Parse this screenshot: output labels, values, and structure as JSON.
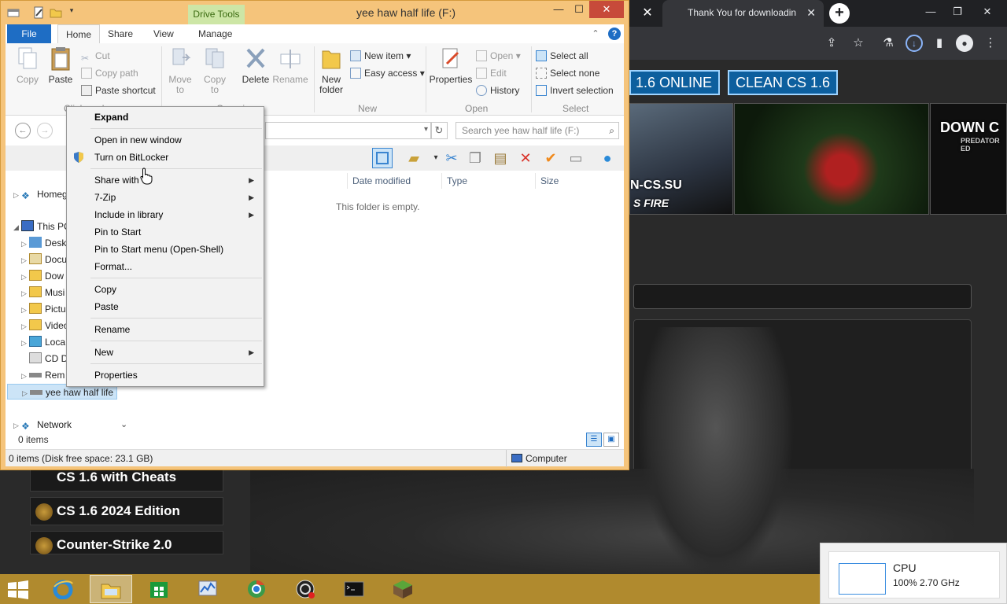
{
  "browser": {
    "tab_title": "Thank You for downloadin",
    "site": {
      "buttons": [
        "1.6 ONLINE",
        "CLEAN CS 1.6"
      ],
      "thumb_texts": [
        "N-CS.SU",
        "S FIRE",
        "DOWN C",
        "PREDATOR ED"
      ],
      "side_items": [
        "CS 1.6 with Cheats",
        "CS 1.6 2024 Edition",
        "Counter-Strike 2.0"
      ]
    }
  },
  "explorer": {
    "contextual_tab": "Drive Tools",
    "title": "yee haw half life (F:)",
    "tabs": {
      "file": "File",
      "home": "Home",
      "share": "Share",
      "view": "View",
      "manage": "Manage"
    },
    "ribbon": {
      "copy": "Copy",
      "paste": "Paste",
      "cut": "Cut",
      "copy_path": "Copy path",
      "paste_shortcut": "Paste shortcut",
      "clipboard_label": "Clipboard",
      "move_to": "Move\nto",
      "copy_to": "Copy\nto",
      "delete": "Delete",
      "rename": "Rename",
      "organize_label": "Organize",
      "new_folder": "New\nfolder",
      "new_item": "New item",
      "easy_access": "Easy access",
      "new_label": "New",
      "properties": "Properties",
      "open": "Open",
      "edit": "Edit",
      "history": "History",
      "open_label": "Open",
      "select_all": "Select all",
      "select_none": "Select none",
      "invert_selection": "Invert selection",
      "select_label": "Select"
    },
    "search_placeholder": "Search yee haw half life (F:)",
    "nav": {
      "homegroup": "Homeg",
      "this_pc": "This PC",
      "desktop": "Desk",
      "documents": "Docu",
      "downloads": "Dow",
      "music": "Musi",
      "pictures": "Pictu",
      "videos": "Video",
      "local_disk": "Loca",
      "cd_drive": "CD D",
      "removable": "Rem",
      "drive": "yee haw half life",
      "network": "Network"
    },
    "columns": {
      "date_modified": "Date modified",
      "type": "Type",
      "size": "Size"
    },
    "empty_message": "This folder is empty.",
    "item_count": "0 items",
    "status_left": "0 items (Disk free space: 23.1 GB)",
    "status_right": "Computer"
  },
  "context_menu": {
    "expand": "Expand",
    "open_new_window": "Open in new window",
    "bitlocker": "Turn on BitLocker",
    "share_with": "Share with",
    "seven_zip": "7-Zip",
    "include_library": "Include in library",
    "pin_start": "Pin to Start",
    "pin_start_openshell": "Pin to Start menu (Open-Shell)",
    "format": "Format...",
    "copy": "Copy",
    "paste": "Paste",
    "rename": "Rename",
    "new": "New",
    "properties": "Properties"
  },
  "cpu_widget": {
    "name": "CPU",
    "value": "100%  2.70 GHz"
  },
  "colors": {
    "title_bar": "#f5c47b",
    "file_tab": "#1e6dc4",
    "taskbar": "#b08a2e",
    "close_button": "#c74a3a"
  }
}
